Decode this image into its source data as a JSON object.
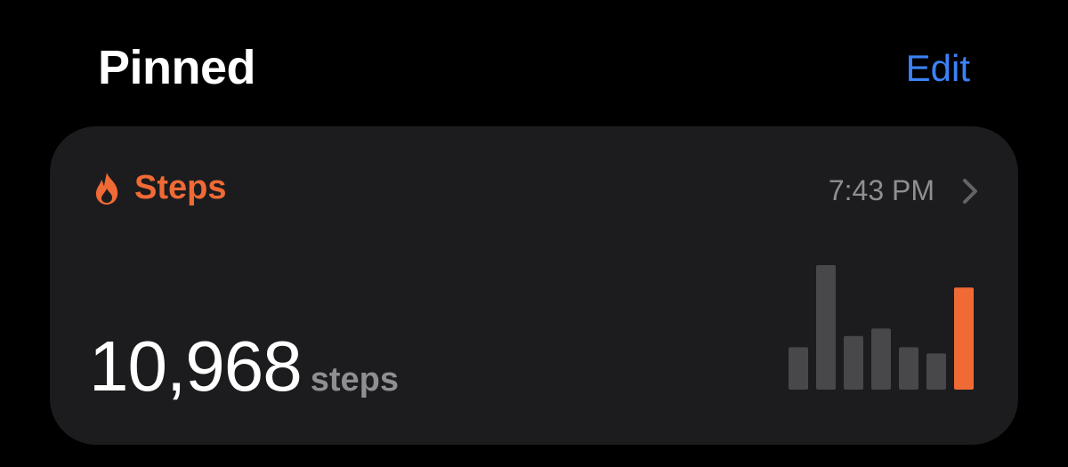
{
  "header": {
    "title": "Pinned",
    "edit_label": "Edit",
    "edit_color": "#3b82f6"
  },
  "card": {
    "icon": "flame-icon",
    "title": "Steps",
    "time": "7:43 PM",
    "value": "10,968",
    "unit": "steps",
    "accent_color": "#f06a35",
    "chevron_icon": "chevron-right-icon"
  },
  "chart_data": {
    "type": "bar",
    "values": [
      34,
      100,
      43,
      49,
      34,
      29,
      82
    ],
    "highlight_index": 6,
    "bar_color": "#48484a",
    "highlight_color": "#f06a35"
  }
}
